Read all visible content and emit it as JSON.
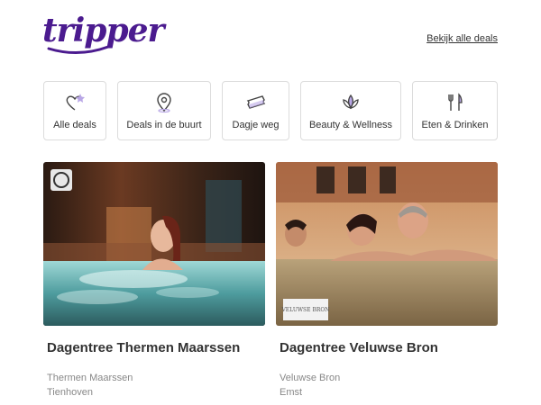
{
  "header": {
    "logo_text": "tripper",
    "all_deals_link": "Bekijk alle deals",
    "brand_color": "#4b1b8f"
  },
  "categories": [
    {
      "label": "Alle deals",
      "icon": "heart-star-icon"
    },
    {
      "label": "Deals in de buurt",
      "icon": "location-pin-icon"
    },
    {
      "label": "Dagje weg",
      "icon": "ticket-icon"
    },
    {
      "label": "Beauty & Wellness",
      "icon": "lotus-icon"
    },
    {
      "label": "Eten & Drinken",
      "icon": "fork-knife-icon"
    }
  ],
  "deals": [
    {
      "title": "Dagentree Thermen Maarssen",
      "location": "Thermen Maarssen",
      "city": "Tienhoven",
      "badge_logo": "thermen-logo"
    },
    {
      "title": "Dagentree Veluwse Bron",
      "location": "Veluwse Bron",
      "city": "Emst",
      "badge_logo": "VELUWSE BRON"
    }
  ]
}
